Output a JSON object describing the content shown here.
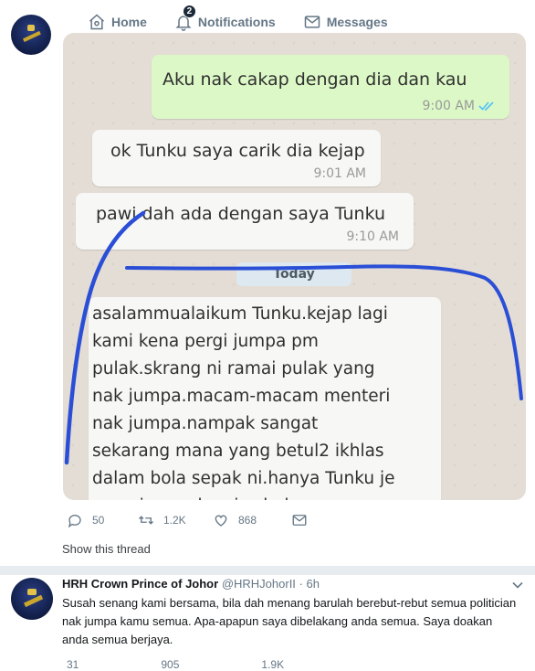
{
  "nav": {
    "home": "Home",
    "notifications": "Notifications",
    "notif_badge": "2",
    "messages": "Messages"
  },
  "chat": {
    "msg_out": {
      "text": "Aku nak cakap dengan dia dan kau",
      "time": "9:00 AM"
    },
    "msg_in1": {
      "text": "ok Tunku saya carik dia kejap",
      "time": "9:01 AM"
    },
    "msg_in2": {
      "text": "pawi dah ada dengan saya Tunku",
      "time": "9:10 AM"
    },
    "date_divider": "Today",
    "msg_in3_lines": [
      "asalammualaikum Tunku.kejap lagi",
      "kami kena pergi jumpa pm",
      "pulak.skrang ni ramai pulak yang",
      "nak jumpa.macam-macam menteri",
      "nak jumpa.nampak sangat",
      "sekarang mana yang betul2 ikhlas",
      "dalam bola sepak ni.hanya Tunku je",
      "yang jumpa kami sebelum game"
    ],
    "ink_color": "#2a4fd6"
  },
  "tweet1": {
    "replies": "50",
    "retweets": "1.2K",
    "likes": "868",
    "show_thread": "Show this thread"
  },
  "tweet2": {
    "name": "HRH Crown Prince of Johor",
    "handle": "@HRHJohorII",
    "time": "· 6h",
    "body": "Susah senang kami bersama, bila dah menang barulah berebut-rebut semua politician nak jumpa kamu semua. Apa-apapun saya dibelakang anda semua. Saya doakan anda semua berjaya.",
    "replies_partial": "31",
    "retweets_partial": "905",
    "likes_partial": "1.9K"
  },
  "colors": {
    "icon_gray": "#657786",
    "bubble_out": "#dcf8c6",
    "bubble_in": "#f7f7f5",
    "chat_bg": "#e4ddd5",
    "read_ticks": "#4fc3f7"
  }
}
